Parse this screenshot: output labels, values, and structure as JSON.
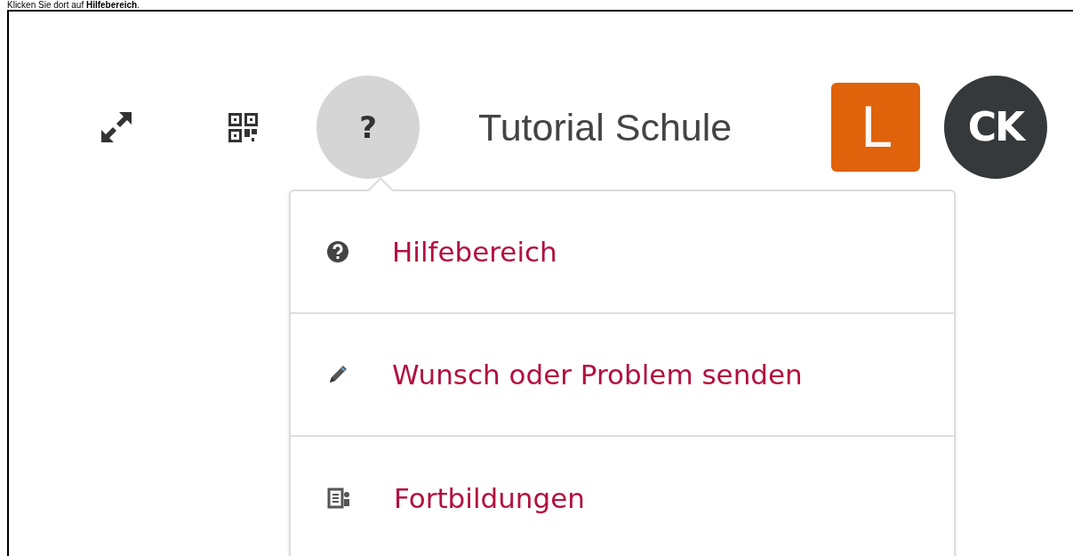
{
  "caption": "Klicken Sie dort auf **Hilfebereich**.",
  "toolbar": {
    "help_button": {
      "label": "?",
      "expanded": true
    },
    "school_name": "Tutorial Schule",
    "app_badge": "L",
    "avatar": "CK"
  },
  "help_menu": [
    {
      "kind": "help",
      "label": "Hilfebereich"
    },
    {
      "kind": "edit",
      "label": "Wunsch oder Problem senden"
    },
    {
      "kind": "courses",
      "label": "Fortbildungen"
    }
  ]
}
